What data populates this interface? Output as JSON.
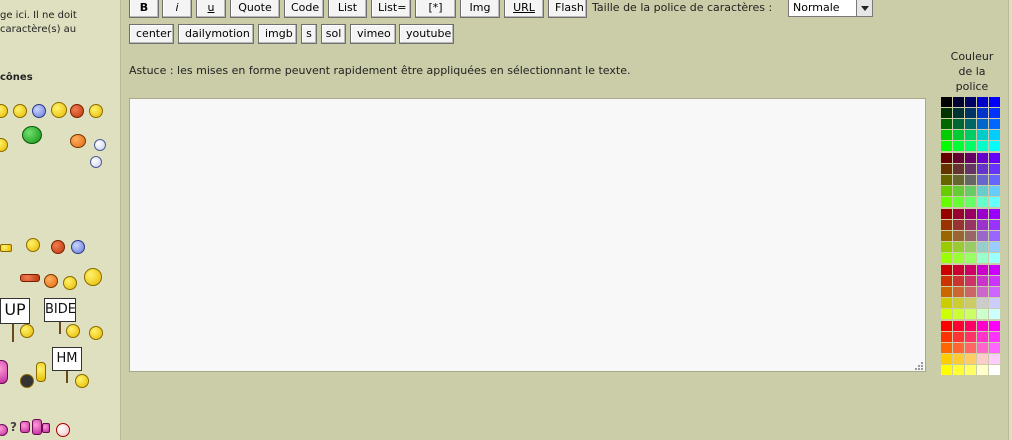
{
  "sidebar": {
    "help_text_line1": "ge ici. Il ne doit",
    "help_text_line2": "caractère(s) au",
    "smileys_title": "cônes",
    "sign_up": "UP",
    "sign_bide": "BIDE",
    "sign_hm": "HM",
    "bottom_glyphs": "?"
  },
  "toolbar": {
    "row1": [
      {
        "label": "B",
        "name": "bold-button"
      },
      {
        "label": "i",
        "name": "italic-button"
      },
      {
        "label": "u",
        "name": "underline-button"
      },
      {
        "label": "Quote",
        "name": "quote-button"
      },
      {
        "label": "Code",
        "name": "code-button"
      },
      {
        "label": "List",
        "name": "list-button"
      },
      {
        "label": "List=",
        "name": "ordered-list-button"
      },
      {
        "label": "[*]",
        "name": "list-item-button"
      },
      {
        "label": "Img",
        "name": "img-button"
      },
      {
        "label": "URL",
        "name": "url-button"
      },
      {
        "label": "Flash",
        "name": "flash-button"
      }
    ],
    "font_size_label": "Taille de la police de caractères :",
    "font_size_value": "Normale",
    "row2": [
      {
        "label": "center",
        "name": "center-button"
      },
      {
        "label": "dailymotion",
        "name": "dailymotion-button"
      },
      {
        "label": "imgb",
        "name": "imgb-button"
      },
      {
        "label": "s",
        "name": "strike-button"
      },
      {
        "label": "sol",
        "name": "sol-button"
      },
      {
        "label": "vimeo",
        "name": "vimeo-button"
      },
      {
        "label": "youtube",
        "name": "youtube-button"
      }
    ]
  },
  "editor": {
    "hint": "Astuce : les mises en forme peuvent rapidement être appliquées en sélectionnant le texte.",
    "message_value": ""
  },
  "color_palette": {
    "title_line1": "Couleur",
    "title_line2": "de la",
    "title_line3": "police"
  }
}
